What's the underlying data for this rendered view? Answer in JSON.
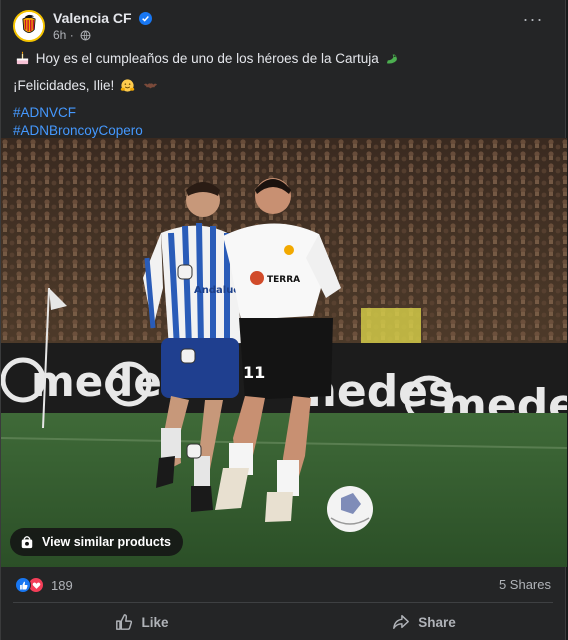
{
  "post": {
    "page_name": "Valencia CF",
    "time": "6h",
    "more_label": "···",
    "icons": [
      "verified-badge-icon",
      "globe-icon",
      "more-options-icon"
    ],
    "text_line1": "Hoy es el cumpleaños de uno de los héroes de la Cartuja",
    "text_line2": "¡Felicidades, Ilie!",
    "hashtags": [
      "#ADNVCF",
      "#ADNBroncoyCopero"
    ],
    "emojis": [
      "birthday-cake-icon",
      "dragon-icon",
      "hugging-face-icon",
      "bat-icon"
    ]
  },
  "photo": {
    "overlay_button": "View similar products",
    "ad_board_text": [
      "medes",
      "medes",
      "medes"
    ],
    "player_number": "11",
    "shirt_sponsor": "Andalucía"
  },
  "stats": {
    "reactions": [
      "like-reaction-icon",
      "love-reaction-icon"
    ],
    "reaction_count": "189",
    "shares": "5 Shares"
  },
  "actions": {
    "like": "Like",
    "share": "Share"
  },
  "colors": {
    "background": "#242526",
    "text": "#e4e6eb",
    "secondary_text": "#b0b3b8",
    "hashtag": "#4599ff",
    "like_blue": "#1877f2",
    "love_red": "#f33e58"
  }
}
